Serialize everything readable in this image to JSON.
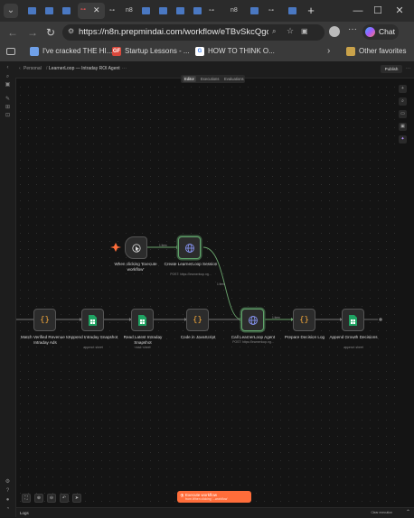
{
  "browser": {
    "url": "https://n8n.prepmindai.com/workflow/eTBvSkcQgoGC...",
    "tabs": [
      {
        "kind": "doc",
        "color": "#4a78c2"
      },
      {
        "kind": "doc",
        "color": "#4a78c2"
      },
      {
        "kind": "n8n",
        "active": true
      },
      {
        "kind": "n8n"
      },
      {
        "kind": "doc",
        "color": "#4a78c2"
      },
      {
        "kind": "doc",
        "color": "#4a78c2"
      },
      {
        "kind": "doc",
        "color": "#4a78c2"
      },
      {
        "kind": "n8n"
      },
      {
        "kind": "n8n"
      },
      {
        "kind": "doc",
        "color": "#4a78c2"
      }
    ],
    "n8n_tab_label": "n8",
    "tab_close_glyph": "✕",
    "new_tab_glyph": "+",
    "chat_label": "Chat",
    "bookmarks": [
      {
        "label": "I've cracked THE HI...",
        "icon_text": "",
        "icon_color": "#6fa0e8"
      },
      {
        "label": "Startup Lessons - ...",
        "icon_text": "GF",
        "icon_color": "#d9483b"
      },
      {
        "label": "HOW TO THINK O...",
        "icon_text": "G",
        "icon_color": "#ffffff"
      }
    ],
    "other_favorites": "Other favorites"
  },
  "app": {
    "breadcrumb_personal": "Personal",
    "workflow_title": "LearnerLoop — Intraday ROI Agent",
    "more": "···",
    "publish_label": "Publish",
    "tabs": [
      "Editor",
      "Executions",
      "Evaluations"
    ],
    "active_tab": "Editor",
    "accent": "#ff6d3a",
    "highlight": "#5fa36a"
  },
  "nodes": [
    {
      "id": "trigger",
      "label": "When clicking 'Execute workflow'",
      "sub": "",
      "icon": "cursor-icon",
      "type": "trigger"
    },
    {
      "id": "create-session",
      "label": "Create LearnerLoop Session",
      "sub": "POST: https://learnerloop.ng...",
      "icon": "globe-icon",
      "type": "http",
      "highlight": true
    },
    {
      "id": "match-revenue",
      "label": "Match Verified Revenue to Intraday Ads",
      "sub": "",
      "icon": "code-icon",
      "type": "code"
    },
    {
      "id": "append-snapshot",
      "label": "Append Intraday Snapshot",
      "sub": "append: sheet",
      "icon": "sheets-icon",
      "type": "sheets"
    },
    {
      "id": "read-snapshot",
      "label": "Read Latest Intraday Snapshot",
      "sub": "read: sheet",
      "icon": "sheets-icon",
      "type": "sheets"
    },
    {
      "id": "code-js",
      "label": "Code in JavaScript",
      "sub": "",
      "icon": "code-icon",
      "type": "code"
    },
    {
      "id": "call-agent",
      "label": "Call LearnerLoop Agent",
      "sub": "POST: https://learnerloop.ng...",
      "icon": "globe-icon",
      "type": "http",
      "highlight": true
    },
    {
      "id": "prepare-log",
      "label": "Prepare Decision Log",
      "sub": "",
      "icon": "code-icon",
      "type": "code"
    },
    {
      "id": "append-growth",
      "label": "Append Growth Decisions",
      "sub": "append: sheet",
      "icon": "sheets-icon",
      "type": "sheets"
    }
  ],
  "edge_labels": {
    "trigger_to_create": "1 item",
    "create_to_call": "1 item",
    "call_to_prepare": "1 item"
  },
  "execute_button": {
    "title": "Execute workflow",
    "subtitle": "from When clicking '...workflow'"
  },
  "logs": {
    "label": "Logs",
    "clear": "Clear execution"
  }
}
